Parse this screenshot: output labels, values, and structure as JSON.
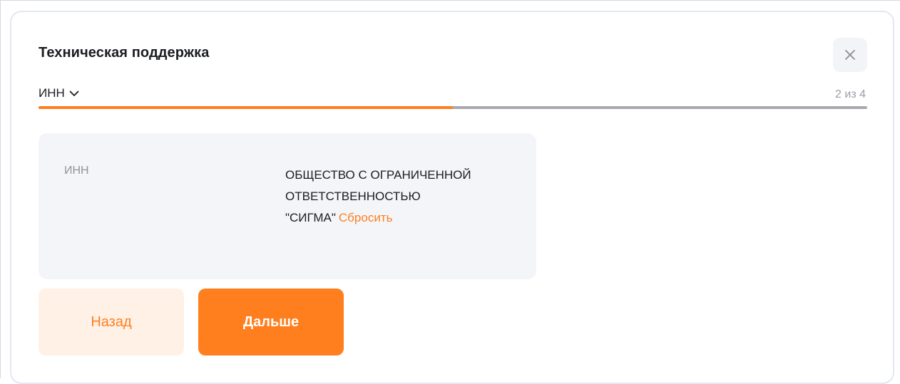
{
  "modal": {
    "title": "Техническая поддержка",
    "step_label": "ИНН",
    "step_counter": "2 из 4",
    "progress_fraction": 0.5,
    "field": {
      "label": "ИНН",
      "value": "ОБЩЕСТВО С ОГРАНИЧЕННОЙ ОТВЕТСТВЕННОСТЬЮ \"СИГМА\"",
      "reset_label": "Сбросить"
    },
    "buttons": {
      "back_label": "Назад",
      "next_label": "Дальше"
    }
  },
  "colors": {
    "accent": "#ff7f1f",
    "accent_light": "#fff1e6",
    "card_bg": "#f4f5f9",
    "track": "#a7aab0"
  },
  "icons": {
    "close": "close-icon",
    "step_dropdown": "chevron-down-icon"
  }
}
